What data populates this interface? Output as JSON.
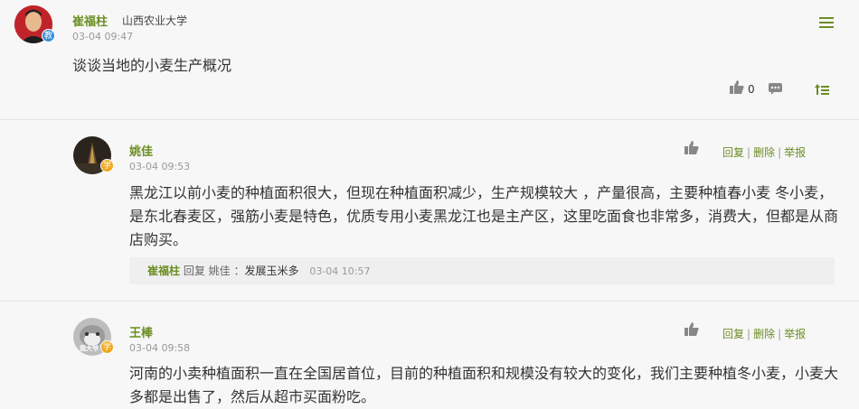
{
  "post": {
    "author": "崔福柱",
    "school": "山西农业大学",
    "badge": "教",
    "time": "03-04 09:47",
    "title": "谈谈当地的小麦生产概况",
    "like_count": "0"
  },
  "replies": [
    {
      "author": "姚佳",
      "badge": "学",
      "time": "03-04 09:53",
      "text": "黑龙江以前小麦的种植面积很大，但现在种植面积减少，生产规模较大 ，产量很高，主要种植春小麦 冬小麦，是东北春麦区，强筋小麦是特色，优质专用小麦黑龙江也是主产区，这里吃面食也非常多，消费大，但都是从商店购买。",
      "actions": {
        "reply": "回复",
        "delete": "删除",
        "report": "举报",
        "sep": "|"
      },
      "subreply": {
        "author": "崔福柱",
        "mid": "回复 姚佳 ：",
        "content": "发展玉米多",
        "time": "03-04 10:57"
      }
    },
    {
      "author": "王棒",
      "badge": "学",
      "time": "03-04 09:58",
      "text": "河南的小卖种植面积一直在全国居首位，目前的种植面积和规模没有较大的变化，我们主要种植冬小麦，小麦大多都是出售了，然后从超市买面粉吃。",
      "actions": {
        "reply": "回复",
        "delete": "删除",
        "report": "举报",
        "sep": "|"
      },
      "avatar_caption": "我大爷"
    }
  ],
  "colors": {
    "accent": "#6b8e23",
    "teacher_badge": "#3a8fd8",
    "student_badge": "#f0a81e"
  },
  "icons": [
    "menu-icon",
    "thumbs-up-icon",
    "comment-icon",
    "sort-up-icon"
  ]
}
